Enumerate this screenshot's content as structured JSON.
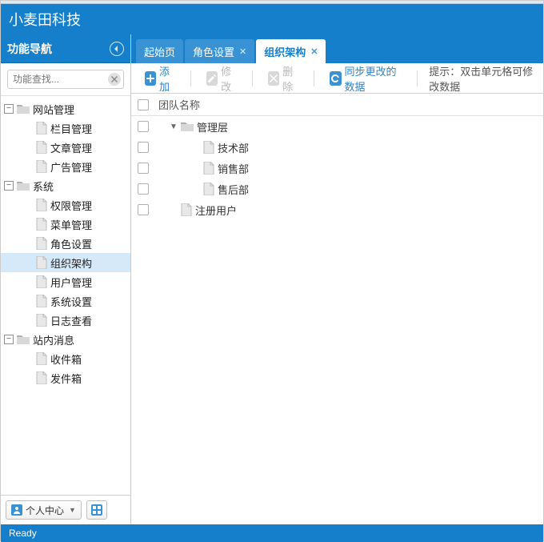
{
  "header": {
    "title": "小麦田科技"
  },
  "sidebar": {
    "title": "功能导航",
    "search_placeholder": "功能查找...",
    "nodes": [
      {
        "label": "网站管理",
        "kind": "folder",
        "depth": 0,
        "expanded": true
      },
      {
        "label": "栏目管理",
        "kind": "file",
        "depth": 1
      },
      {
        "label": "文章管理",
        "kind": "file",
        "depth": 1
      },
      {
        "label": "广告管理",
        "kind": "file",
        "depth": 1
      },
      {
        "label": "系统",
        "kind": "folder",
        "depth": 0,
        "expanded": true
      },
      {
        "label": "权限管理",
        "kind": "file",
        "depth": 1
      },
      {
        "label": "菜单管理",
        "kind": "file",
        "depth": 1
      },
      {
        "label": "角色设置",
        "kind": "file",
        "depth": 1
      },
      {
        "label": "组织架构",
        "kind": "file",
        "depth": 1,
        "selected": true
      },
      {
        "label": "用户管理",
        "kind": "file",
        "depth": 1
      },
      {
        "label": "系统设置",
        "kind": "file",
        "depth": 1
      },
      {
        "label": "日志查看",
        "kind": "file",
        "depth": 1
      },
      {
        "label": "站内消息",
        "kind": "folder",
        "depth": 0,
        "expanded": true
      },
      {
        "label": "收件箱",
        "kind": "file",
        "depth": 1
      },
      {
        "label": "发件箱",
        "kind": "file",
        "depth": 1
      }
    ],
    "user_menu": "个人中心"
  },
  "tabs": [
    {
      "label": "起始页",
      "closable": false,
      "active": false
    },
    {
      "label": "角色设置",
      "closable": true,
      "active": false
    },
    {
      "label": "组织架构",
      "closable": true,
      "active": true
    }
  ],
  "toolbar": {
    "add": "添加",
    "edit": "修改",
    "del": "删除",
    "sync": "同步更改的数据",
    "hint": "提示：双击单元格可修改数据"
  },
  "grid": {
    "column": "团队名称",
    "rows": [
      {
        "label": "管理层",
        "kind": "folder",
        "depth": 0,
        "expanded": true
      },
      {
        "label": "技术部",
        "kind": "file",
        "depth": 1
      },
      {
        "label": "销售部",
        "kind": "file",
        "depth": 1
      },
      {
        "label": "售后部",
        "kind": "file",
        "depth": 1
      },
      {
        "label": "注册用户",
        "kind": "file",
        "depth": 0
      }
    ]
  },
  "footer": {
    "status": "Ready"
  }
}
